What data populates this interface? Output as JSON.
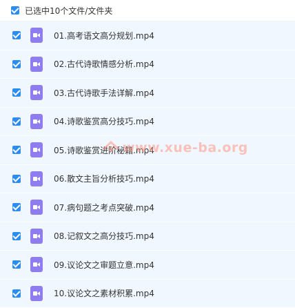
{
  "header": {
    "label": "已选中10个文件/文件夹"
  },
  "files": [
    {
      "name": "01.高考语文高分规划.mp4",
      "icon": "video-file-icon"
    },
    {
      "name": "02.古代诗歌情感分析.mp4",
      "icon": "video-file-icon"
    },
    {
      "name": "03.古代诗歌手法详解.mp4",
      "icon": "video-file-icon"
    },
    {
      "name": "04.诗歌鉴赏高分技巧.mp4",
      "icon": "video-file-icon"
    },
    {
      "name": "05.诗歌鉴赏进阶秘籍.mp4",
      "icon": "video-file-icon"
    },
    {
      "name": "06.散文主旨分析技巧.mp4",
      "icon": "video-file-icon"
    },
    {
      "name": "07.病句题之考点突破.mp4",
      "icon": "video-file-icon"
    },
    {
      "name": "08.记叙文之高分技巧.mp4",
      "icon": "video-file-icon"
    },
    {
      "name": "09.议论文之审题立意.mp4",
      "icon": "video-file-icon"
    },
    {
      "name": "10.议论文之素材积累.mp4",
      "icon": "video-file-icon"
    }
  ],
  "watermark": {
    "text": "www.xue-ba.org"
  },
  "colors": {
    "accent": "#2d8cf0",
    "row_bg": "#f1f7ff",
    "file_icon": "#8f7df0"
  }
}
